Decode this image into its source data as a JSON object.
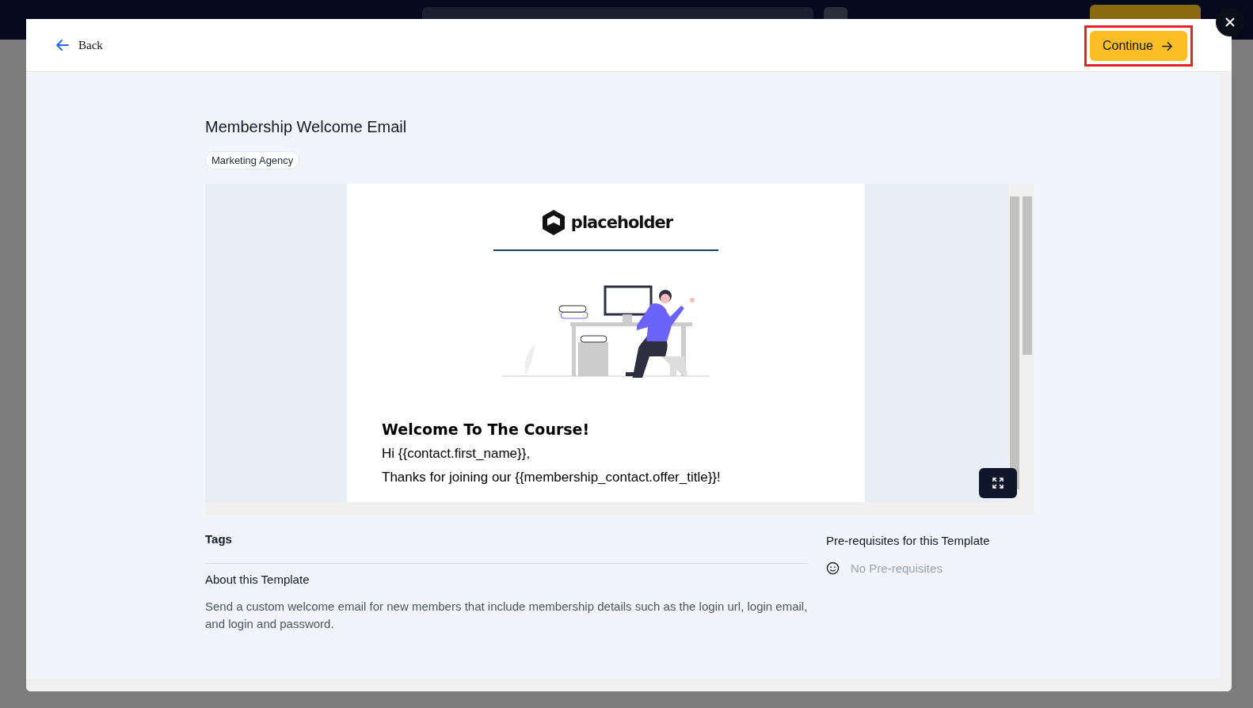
{
  "header": {
    "back_label": "Back",
    "continue_label": "Continue",
    "continue_highlighted": true
  },
  "template": {
    "title": "Membership Welcome Email",
    "category_tag": "Marketing Agency"
  },
  "preview": {
    "logo_text": "placeholder",
    "heading": "Welcome To The Course!",
    "lines": [
      "Hi {{contact.first_name}},",
      "Thanks for joining our {{membership_contact.offer_title}}!"
    ]
  },
  "tags": {
    "heading": "Tags"
  },
  "about": {
    "heading": "About this Template",
    "description": "Send a custom welcome email for new members that include membership details such as the login url, login email, and login and password."
  },
  "prerequisites": {
    "heading": "Pre-requisites for this Template",
    "empty_text": "No Pre-requisites"
  }
}
